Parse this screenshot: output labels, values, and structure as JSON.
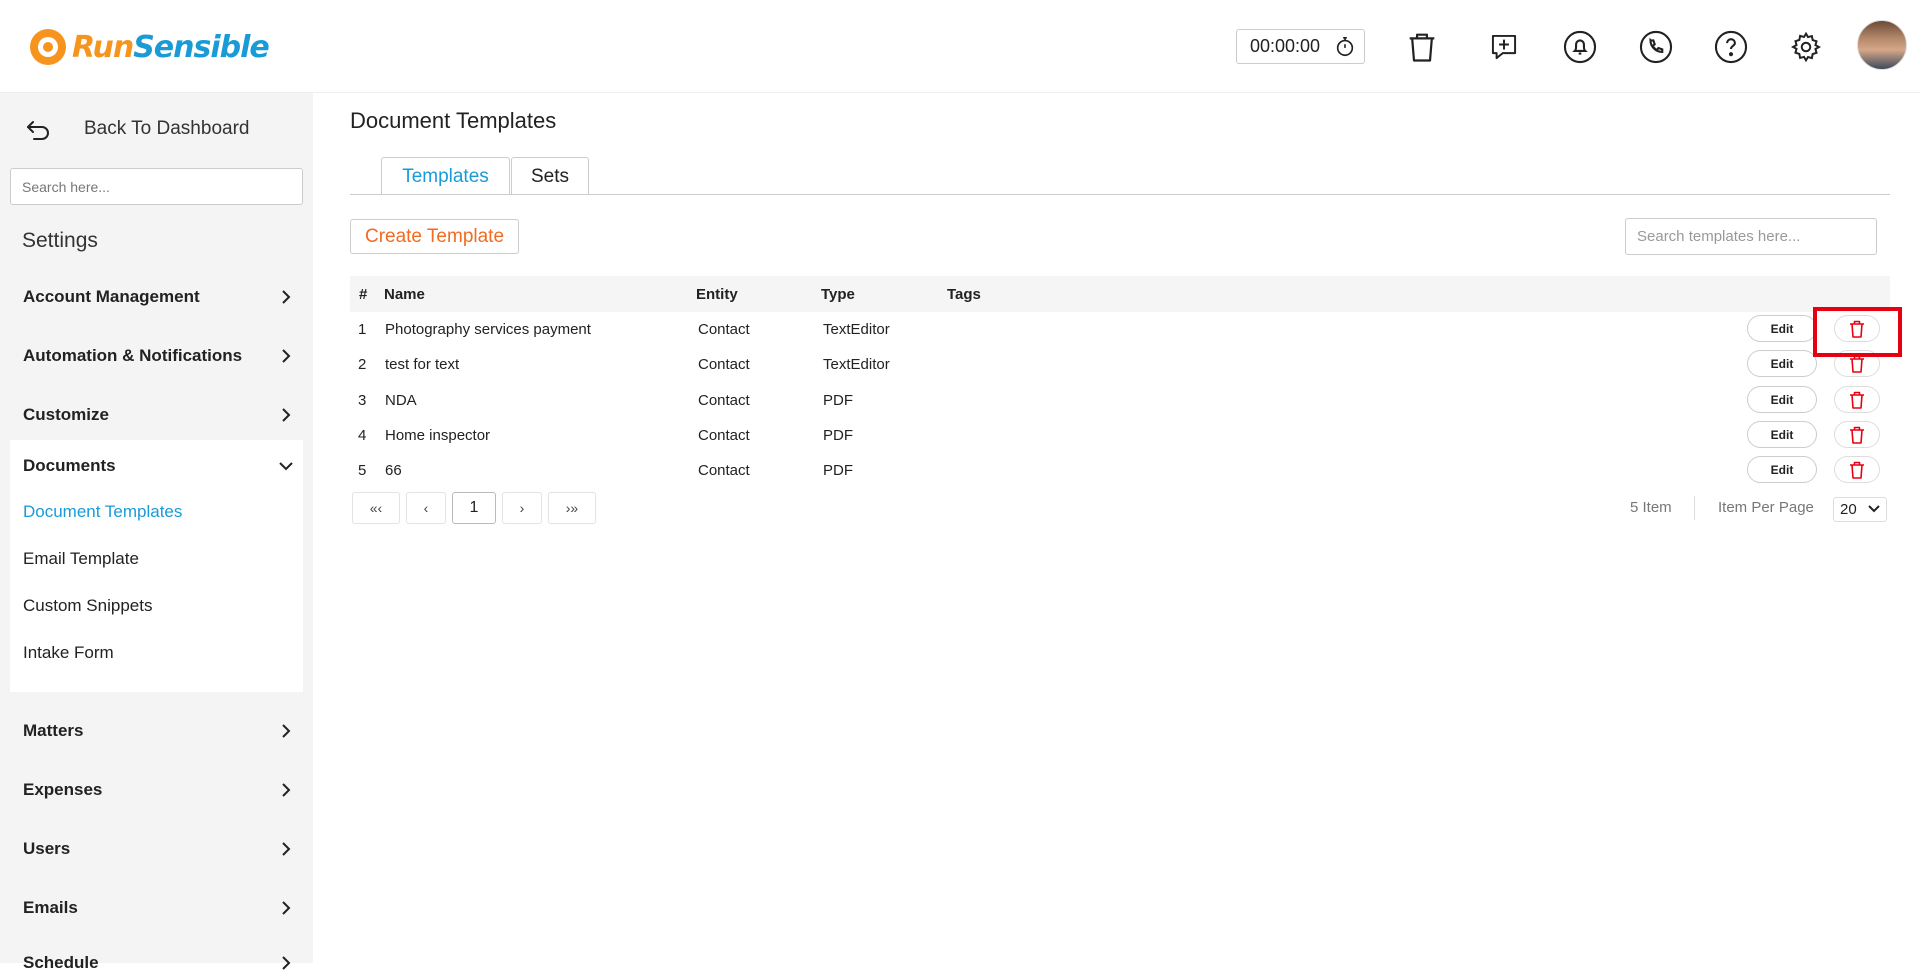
{
  "header": {
    "logo_run": "Run",
    "logo_sensible": "Sensible",
    "timer": "00:00:00",
    "icons": [
      "stopwatch-icon",
      "trash-icon",
      "add-transfer-icon",
      "bell-icon",
      "phone-icon",
      "help-icon",
      "gear-icon",
      "avatar"
    ]
  },
  "sidebar": {
    "back_label": "Back To Dashboard",
    "search_placeholder": "Search here...",
    "settings_title": "Settings",
    "items": [
      {
        "label": "Account Management"
      },
      {
        "label": "Automation & Notifications"
      },
      {
        "label": "Customize"
      },
      {
        "label": "Documents"
      },
      {
        "label": "Matters"
      },
      {
        "label": "Expenses"
      },
      {
        "label": "Users"
      },
      {
        "label": "Emails"
      },
      {
        "label": "Schedule"
      }
    ],
    "documents_sub": [
      {
        "label": "Document Templates",
        "active": true
      },
      {
        "label": "Email Template"
      },
      {
        "label": "Custom Snippets"
      },
      {
        "label": "Intake Form"
      }
    ]
  },
  "main": {
    "title": "Document Templates",
    "tabs": [
      {
        "label": "Templates",
        "active": true
      },
      {
        "label": "Sets"
      }
    ],
    "create_label": "Create Template",
    "search_placeholder": "Search templates here...",
    "columns": [
      "#",
      "Name",
      "Entity",
      "Type",
      "Tags"
    ],
    "rows": [
      {
        "num": "1",
        "name": "Photography services payment",
        "entity": "Contact",
        "type": "TextEditor",
        "tags": ""
      },
      {
        "num": "2",
        "name": "test for text",
        "entity": "Contact",
        "type": "TextEditor",
        "tags": ""
      },
      {
        "num": "3",
        "name": "NDA",
        "entity": "Contact",
        "type": "PDF",
        "tags": ""
      },
      {
        "num": "4",
        "name": "Home inspector",
        "entity": "Contact",
        "type": "PDF",
        "tags": ""
      },
      {
        "num": "5",
        "name": "66",
        "entity": "Contact",
        "type": "PDF",
        "tags": ""
      }
    ],
    "edit_label": "Edit",
    "pager": {
      "first": "«‹",
      "prev": "‹",
      "current": "1",
      "next": "›",
      "last": "›»",
      "items_count": "5 Item",
      "per_page_label": "Item Per Page",
      "per_page_value": "20"
    }
  },
  "colors": {
    "brand_orange": "#f7941d",
    "brand_blue": "#1a9bd7",
    "create_orange": "#f26b21",
    "delete_red": "#e60012",
    "highlight_red": "#e60012"
  }
}
